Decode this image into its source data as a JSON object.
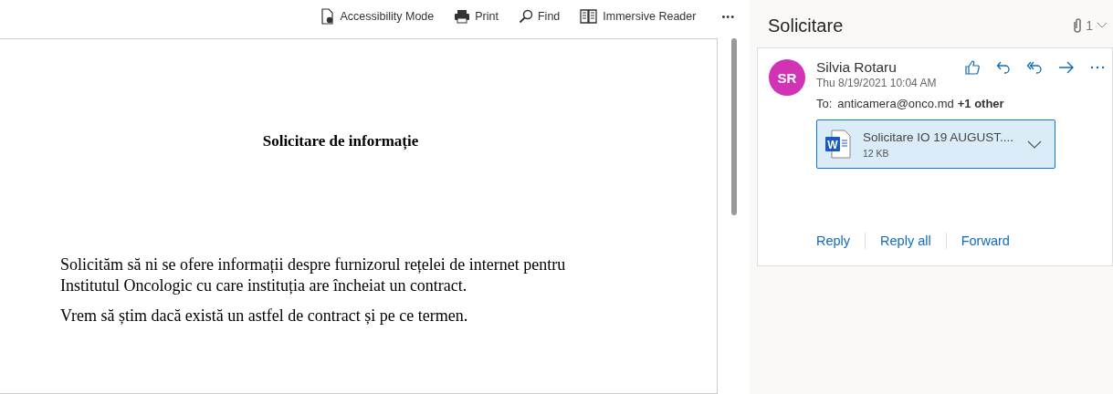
{
  "toolbar": [
    {
      "kind": "accessibility",
      "label": "Accessibility Mode"
    },
    {
      "kind": "print",
      "label": "Print"
    },
    {
      "kind": "find",
      "label": "Find"
    },
    {
      "kind": "reader",
      "label": "Immersive Reader"
    },
    {
      "kind": "more",
      "label": "•••"
    }
  ],
  "document": {
    "title": "Solicitare de informație",
    "paragraphs": [
      "Solicităm să ni se ofere informații despre furnizorul rețelei de internet pentru Institutul Oncologic cu care instituția are încheiat un contract.",
      "Vrem să știm dacă există un astfel de contract și pe ce termen."
    ]
  },
  "message": {
    "subject": "Solicitare",
    "attachment_count": "1",
    "initials": "SR",
    "sender": "Silvia Rotaru",
    "date": "Thu 8/19/2021 10:04 AM",
    "to_label": "To:",
    "to": "anticamera@onco.md",
    "others": "+1 other",
    "actions": [
      {
        "kind": "like"
      },
      {
        "kind": "reply"
      },
      {
        "kind": "reply-all"
      },
      {
        "kind": "forward"
      },
      {
        "kind": "more"
      }
    ],
    "attachment": {
      "icon_letter": "W",
      "name": "Solicitare IO 19 AUGUST....",
      "size": "12 KB",
      "selected": true
    },
    "links": [
      "Reply",
      "Reply all",
      "Forward"
    ]
  }
}
